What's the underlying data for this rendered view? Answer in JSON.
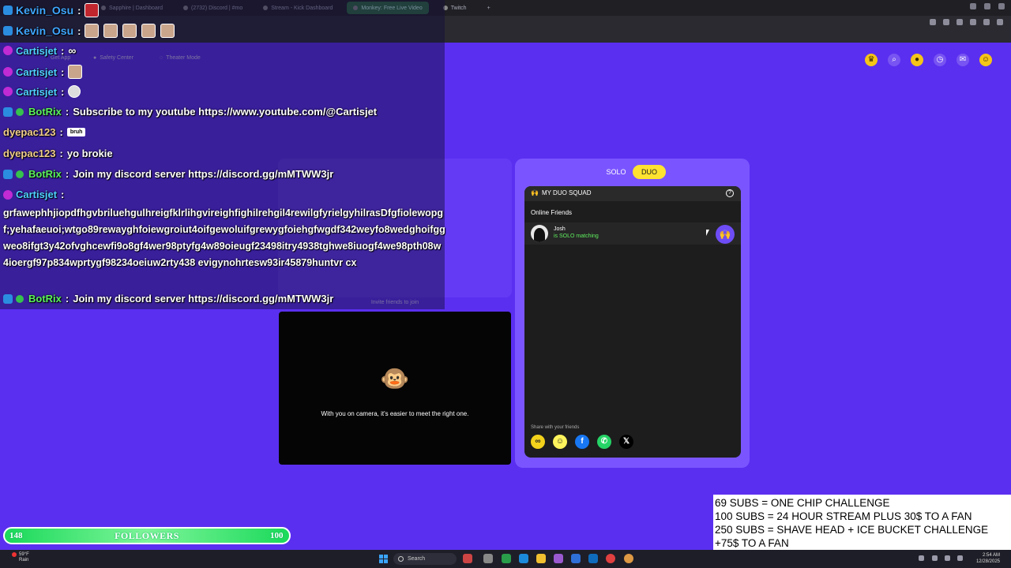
{
  "browser": {
    "tabs": [
      {
        "label": "Sapphire | Dashboard",
        "active": false
      },
      {
        "label": "(2732) Discord | #mo",
        "active": false
      },
      {
        "label": "Stream - Kick Dashboard",
        "active": false
      },
      {
        "label": "Monkey: Free Live Video",
        "active": true
      },
      {
        "label": "Twitch",
        "active": false
      }
    ],
    "new_tab": "+"
  },
  "header": {
    "get_app": "Get App",
    "safety_center": "Safety Center",
    "theater_mode": "Theater Mode"
  },
  "chat": {
    "messages": [
      {
        "user": "Kevin_Osu",
        "text": ""
      },
      {
        "user": "Kevin_Osu",
        "text": ""
      },
      {
        "user": "Cartisjet",
        "text": ""
      },
      {
        "user": "Cartisjet",
        "text": ""
      },
      {
        "user": "Cartisjet",
        "text": ""
      },
      {
        "user": "BotRix",
        "text": "Subscribe to my youtube https://www.youtube.com/@Cartisjet"
      },
      {
        "user": "dyepac123",
        "text": "bruh"
      },
      {
        "user": "dyepac123",
        "text": "yo brokie"
      },
      {
        "user": "BotRix",
        "text": "Join my discord server https://discord.gg/mMTWW3jr"
      },
      {
        "user": "Cartisjet",
        "text": ""
      },
      {
        "user": "BotRix",
        "text": "Join my discord server https://discord.gg/mMTWW3jr"
      }
    ],
    "long_message": "grfawephhjiopdfhgvbriluehgulhreigfklrlihgvireighfighilrehgil4rewilgfyrielgyhilrasDfgfiolewopgf;yehafaeuoi;wtgo89rewayghfoiewgroiut4oifgewoluifgrewygfoiehgfwgdf342weyfo8wedghoifggweo8ifgt3y42ofvghcewfi9o8gf4wer98ptyfg4w89oieugf23498itry4938tghwe8iuogf4we98pth08w4ioergf97p834wprtygf98234oeiuw2rty438 evigynohrtesw93ir45879huntvr cx",
    "colon": ":"
  },
  "duo": {
    "mode_solo": "SOLO",
    "mode_duo": "DUO",
    "squad_title": "MY DUO SQUAD",
    "help_icon": "?",
    "online_friends": "Online Friends",
    "friend_name": "Josh",
    "friend_status": "is SOLO matching",
    "share_title": "Share with your friends"
  },
  "camera": {
    "invite_text": "Invite friends to join",
    "message": "With you on camera, it's easier to meet the right one."
  },
  "followers": {
    "current": "148",
    "label": "FOLLOWERS",
    "goal": "100",
    "progress": 1.0
  },
  "sub_goals": [
    "69 SUBS = ONE CHIP CHALLENGE",
    "100 SUBS = 24 HOUR STREAM PLUS 30$ TO A FAN",
    "250 SUBS = SHAVE HEAD + ICE BUCKET CHALLENGE",
    "+75$ TO A FAN"
  ],
  "taskbar": {
    "weather_temp": "59°F",
    "weather_desc": "Rain",
    "search_placeholder": "Search",
    "time": "2:54 AM",
    "date": "12/28/2025"
  },
  "colors": {
    "page_bg": "#5b2ff0",
    "duo_yellow": "#ffe330",
    "followers_green": "#1ad95a",
    "botrix_green": "#5af25a"
  }
}
